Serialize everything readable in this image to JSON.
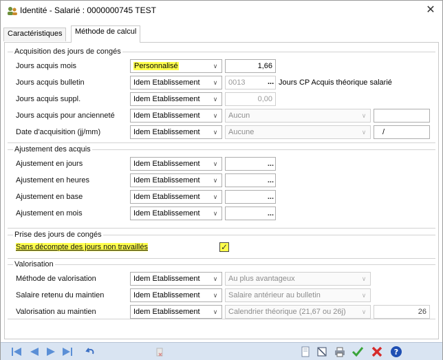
{
  "window": {
    "title": "Identité - Salarié : 0000000745 TEST",
    "close_icon": "close-icon"
  },
  "tabs": [
    {
      "label": "Caractéristiques",
      "active": false
    },
    {
      "label": "Méthode de calcul",
      "active": true
    }
  ],
  "acquisition": {
    "title": "Acquisition des jours de congés",
    "rows": {
      "mois": {
        "label": "Jours acquis mois",
        "mode": "Personnalisé",
        "value": "1,66"
      },
      "bulletin": {
        "label": "Jours acquis bulletin",
        "mode": "Idem Etablissement",
        "code": "0013",
        "ellipsis": "...",
        "side": "Jours CP Acquis théorique salarié"
      },
      "suppl": {
        "label": "Jours acquis suppl.",
        "mode": "Idem Etablissement",
        "value": "0,00"
      },
      "anciennete": {
        "label": "Jours acquis pour ancienneté",
        "mode": "Idem Etablissement",
        "choice": "Aucun",
        "value": ""
      },
      "date": {
        "label": "Date d'acquisition (jj/mm)",
        "mode": "Idem Etablissement",
        "choice": "Aucune",
        "value": "/"
      }
    }
  },
  "ajustement": {
    "title": "Ajustement des acquis",
    "rows": [
      {
        "label": "Ajustement en jours",
        "mode": "Idem Etablissement",
        "ellipsis": "..."
      },
      {
        "label": "Ajustement en heures",
        "mode": "Idem Etablissement",
        "ellipsis": "..."
      },
      {
        "label": "Ajustement en base",
        "mode": "Idem Etablissement",
        "ellipsis": "..."
      },
      {
        "label": "Ajustement en mois",
        "mode": "Idem Etablissement",
        "ellipsis": "..."
      }
    ]
  },
  "prise": {
    "title": "Prise des jours de congés",
    "checkbox_label": "Sans décompte des jours non travaillés",
    "checked_mark": "✓"
  },
  "valorisation": {
    "title": "Valorisation",
    "rows": {
      "methode": {
        "label": "Méthode de valorisation",
        "mode": "Idem Etablissement",
        "choice": "Au plus avantageux"
      },
      "salaire": {
        "label": "Salaire retenu du maintien",
        "mode": "Idem Etablissement",
        "choice": "Salaire antérieur au bulletin"
      },
      "maintien": {
        "label": "Valorisation au maintien",
        "mode": "Idem Etablissement",
        "choice": "Calendrier théorique (21,67 ou 26j)",
        "value": "26"
      }
    }
  },
  "caret": "∨",
  "toolbar": {
    "icons": [
      "first-record-icon",
      "previous-record-icon",
      "next-record-icon",
      "last-record-icon",
      "undo-icon",
      "delete-disabled-icon",
      "print-preview-icon",
      "edit-icon",
      "print-icon",
      "validate-icon",
      "cancel-icon",
      "help-icon"
    ],
    "colors": {
      "bar": "#d9e4f2",
      "nav": "#5b8fd6",
      "ok": "#3aa43a",
      "cancel": "#d62b2b",
      "help": "#1f4fb3"
    }
  }
}
